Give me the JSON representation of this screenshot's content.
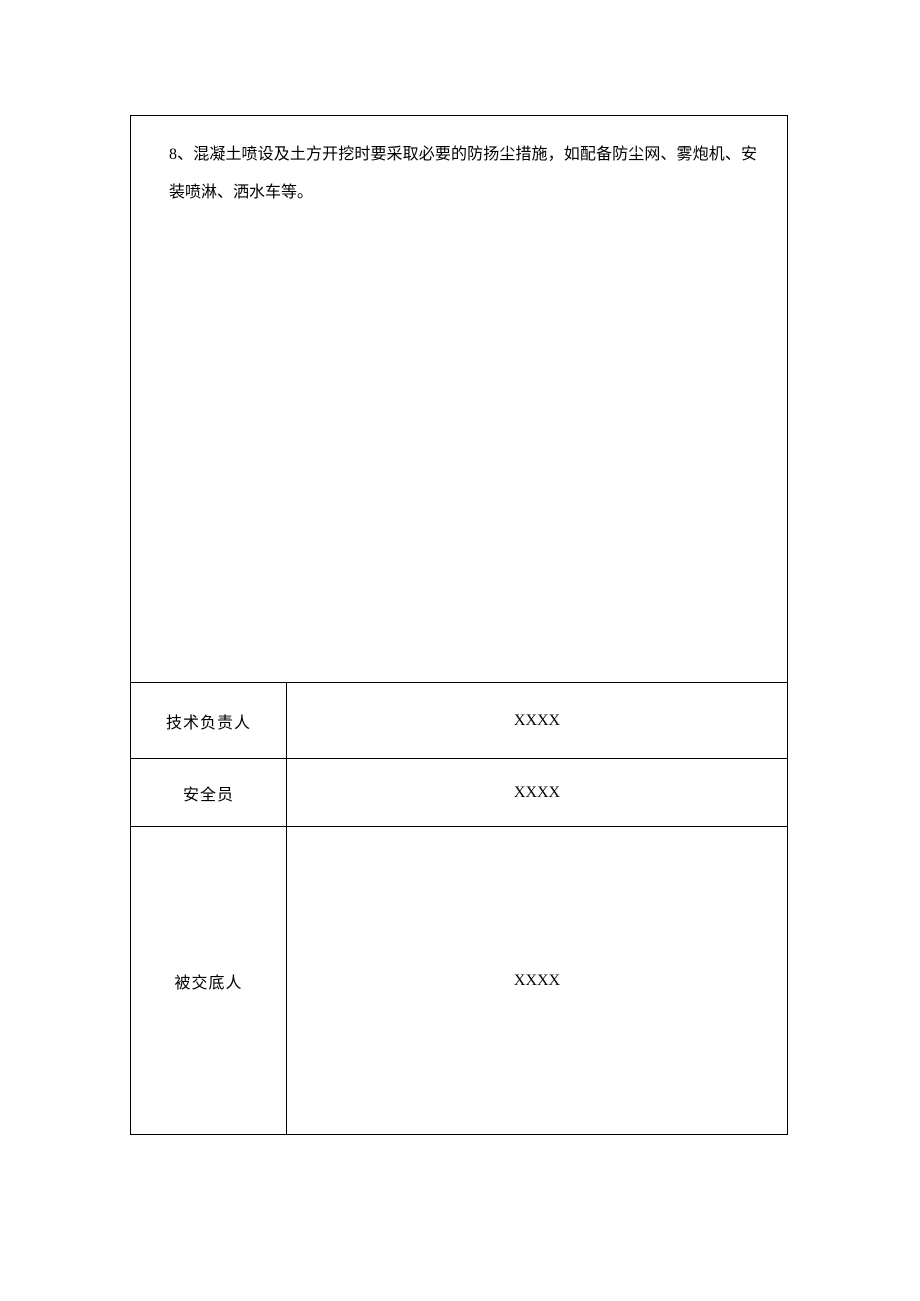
{
  "content": {
    "paragraph": "8、混凝土喷设及土方开挖时要采取必要的防扬尘措施，如配备防尘网、雾炮机、安装喷淋、洒水车等。"
  },
  "rows": {
    "tech": {
      "label": "技术负责人",
      "value": "XXXX"
    },
    "safety": {
      "label": "安全员",
      "value": "XXXX"
    },
    "recipient": {
      "label": "被交底人",
      "value": "XXXX"
    }
  }
}
